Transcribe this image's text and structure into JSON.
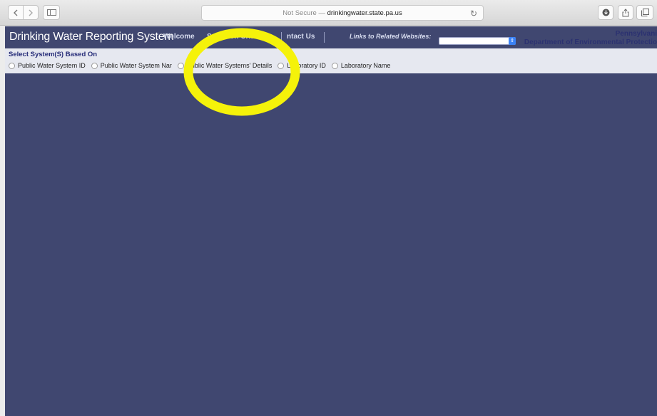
{
  "browser": {
    "address": {
      "security": "Not Secure —",
      "domain": "drinkingwater.state.pa.us"
    }
  },
  "header": {
    "title": "Drinking Water Reporting System",
    "nav": {
      "welcome": "Welcome",
      "selection_criteria": "Selection Criteria",
      "contact_us": "ntact Us"
    },
    "links_label": "Links to Related Websites:",
    "agency_top": "Pennsylvani",
    "agency_bottom": "Department of Environmental Protectio"
  },
  "criteria": {
    "heading": "Select System(S) Based On",
    "options": [
      "Public Water System ID",
      "Public Water System Nar",
      "Public Water Systems' Details",
      "Laboratory ID",
      "Laboratory Name"
    ]
  },
  "colors": {
    "page_background": "#404770",
    "criteria_background": "#e6e8f0",
    "highlight": "#f5f20a"
  }
}
